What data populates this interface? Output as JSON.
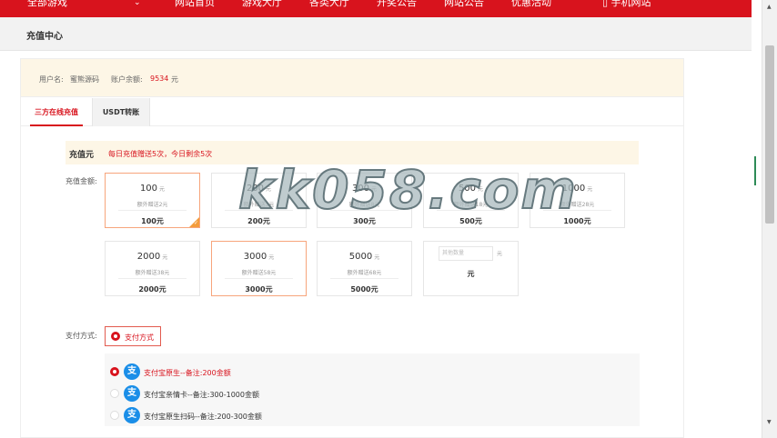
{
  "topnav": {
    "all_games": "全部游戏",
    "caret": "⌄",
    "items": [
      "网站首页",
      "游戏大厅",
      "各类大厅",
      "开奖公告",
      "网站公告",
      "优惠活动"
    ],
    "mobile": "▯ 手机网站"
  },
  "header": {
    "title": "充值中心"
  },
  "user": {
    "name_label": "用户名:",
    "name": "蜜熊源码",
    "balance_label": "账户余额:",
    "balance": "9534",
    "balance_unit": "元"
  },
  "tabs": [
    {
      "label": "三方在线充值",
      "active": true
    },
    {
      "label": "USDT转账",
      "active": false
    }
  ],
  "promo": {
    "title": "充值元",
    "note": "每日充值赠送5次，今日剩余5次"
  },
  "amount_label": "充值金额:",
  "amounts": [
    {
      "amount": "100",
      "unit": "元",
      "bonus": "额外赠送2元",
      "total": "100元",
      "selected": true
    },
    {
      "amount": "200",
      "unit": "元",
      "bonus": "额外赠送3元",
      "total": "200元",
      "selected": false
    },
    {
      "amount": "300",
      "unit": "元",
      "bonus": "额外赠送8元",
      "total": "300元",
      "selected": false
    },
    {
      "amount": "500",
      "unit": "元",
      "bonus": "额外赠送18元",
      "total": "500元",
      "selected": false
    },
    {
      "amount": "1000",
      "unit": "元",
      "bonus": "额外赠送28元",
      "total": "1000元",
      "selected": false
    },
    {
      "amount": "2000",
      "unit": "元",
      "bonus": "额外赠送38元",
      "total": "2000元",
      "selected": false
    },
    {
      "amount": "3000",
      "unit": "元",
      "bonus": "额外赠送58元",
      "total": "3000元",
      "selected": false
    },
    {
      "amount": "5000",
      "unit": "元",
      "bonus": "额外赠送68元",
      "total": "5000元",
      "selected": false
    }
  ],
  "custom": {
    "placeholder": "其他数量",
    "unit": "元",
    "total": "元"
  },
  "pay": {
    "label": "支付方式:",
    "button": "支付方式",
    "options": [
      {
        "label": "支付宝原生--备注:200金额",
        "selected": true
      },
      {
        "label": "支付宝亲情卡--备注:300-1000金额",
        "selected": false
      },
      {
        "label": "支付宝原生扫码--备注:200-300金额",
        "selected": false
      }
    ]
  },
  "icons": {
    "alipay": "alipay-icon",
    "radio": "radio-icon",
    "check": "check-icon"
  },
  "colors": {
    "brand": "#d8131d",
    "promo_bg": "#fdf6e6",
    "alipay": "#1a8ee8",
    "corner": "#f39c3b"
  },
  "watermark": "kk058.com"
}
